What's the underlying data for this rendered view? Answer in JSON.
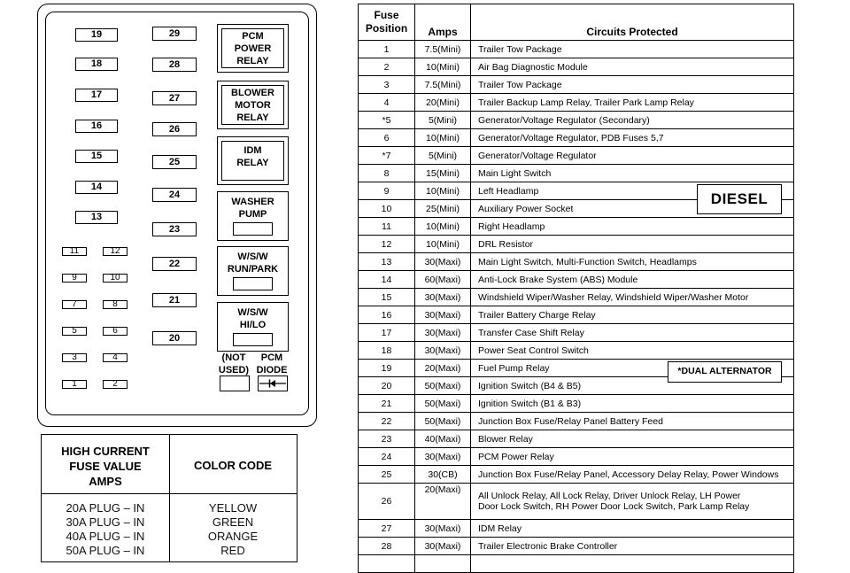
{
  "fuse_box": {
    "left_column_fuses": [
      "19",
      "18",
      "17",
      "16",
      "15",
      "14",
      "13"
    ],
    "middle_column_fuses": [
      "29",
      "28",
      "27",
      "26",
      "25",
      "24",
      "23",
      "22",
      "21",
      "20"
    ],
    "mini_fuses": [
      [
        "11",
        "12"
      ],
      [
        "9",
        "10"
      ],
      [
        "7",
        "8"
      ],
      [
        "5",
        "6"
      ],
      [
        "3",
        "4"
      ],
      [
        "1",
        "2"
      ]
    ],
    "relays": [
      {
        "label": "PCM\nPOWER\nRELAY",
        "style": "inner-box"
      },
      {
        "label": "BLOWER\nMOTOR\nRELAY",
        "style": "inner-box"
      },
      {
        "label": "IDM\nRELAY",
        "style": "inner-box"
      },
      {
        "label": "WASHER\nPUMP",
        "style": "slot"
      },
      {
        "label": "W/S/W\nRUN/PARK",
        "style": "slot"
      },
      {
        "label": "W/S/W\nHI/LO",
        "style": "slot"
      }
    ],
    "not_used_label": "(NOT\nUSED)",
    "pcm_diode_label": "PCM\nDIODE"
  },
  "color_code_table": {
    "header_left": "HIGH CURRENT\nFUSE VALUE\nAMPS",
    "header_right": "COLOR CODE",
    "rows": [
      {
        "value": "20A PLUG – IN",
        "color": "YELLOW"
      },
      {
        "value": "30A PLUG – IN",
        "color": "GREEN"
      },
      {
        "value": "40A PLUG – IN",
        "color": "ORANGE"
      },
      {
        "value": "50A PLUG – IN",
        "color": "RED"
      }
    ]
  },
  "fuse_table": {
    "headers": {
      "position": "Fuse\nPosition",
      "amps": "Amps",
      "circuits": "Circuits Protected"
    },
    "rows": [
      {
        "pos": "1",
        "amps": "7.5(Mini)",
        "circuits": "Trailer Tow Package"
      },
      {
        "pos": "2",
        "amps": "10(Mini)",
        "circuits": "Air Bag Diagnostic Module"
      },
      {
        "pos": "3",
        "amps": "7.5(Mini)",
        "circuits": "Trailer Tow Package"
      },
      {
        "pos": "4",
        "amps": "20(Mini)",
        "circuits": "Trailer Backup Lamp Relay, Trailer Park Lamp Relay"
      },
      {
        "pos": "*5",
        "amps": "5(Mini)",
        "circuits": "Generator/Voltage Regulator (Secondary)"
      },
      {
        "pos": "6",
        "amps": "10(Mini)",
        "circuits": "Generator/Voltage  Regulator, PDB Fuses 5,7"
      },
      {
        "pos": "*7",
        "amps": "5(Mini)",
        "circuits": "Generator/Voltage Regulator"
      },
      {
        "pos": "8",
        "amps": "15(Mini)",
        "circuits": "Main Light Switch"
      },
      {
        "pos": "9",
        "amps": "10(Mini)",
        "circuits": "Left Headlamp"
      },
      {
        "pos": "10",
        "amps": "25(Mini)",
        "circuits": "Auxiliary Power Socket"
      },
      {
        "pos": "11",
        "amps": "10(Mini)",
        "circuits": "Right Headlamp"
      },
      {
        "pos": "12",
        "amps": "10(Mini)",
        "circuits": "DRL Resistor"
      },
      {
        "pos": "13",
        "amps": "30(Maxi)",
        "circuits": "Main Light Switch, Multi-Function Switch, Headlamps"
      },
      {
        "pos": "14",
        "amps": "60(Maxi)",
        "circuits": "Anti-Lock Brake System (ABS) Module"
      },
      {
        "pos": "15",
        "amps": "30(Maxi)",
        "circuits": "Windshield Wiper/Washer Relay, Windshield Wiper/Washer Motor"
      },
      {
        "pos": "16",
        "amps": "30(Maxi)",
        "circuits": "Trailer Battery Charge Relay"
      },
      {
        "pos": "17",
        "amps": "30(Maxi)",
        "circuits": "Transfer Case Shift Relay"
      },
      {
        "pos": "18",
        "amps": "30(Maxi)",
        "circuits": "Power Seat Control Switch"
      },
      {
        "pos": "19",
        "amps": "20(Maxi)",
        "circuits": "Fuel Pump Relay"
      },
      {
        "pos": "20",
        "amps": "50(Maxi)",
        "circuits": "Ignition Switch (B4 & B5)"
      },
      {
        "pos": "21",
        "amps": "50(Maxi)",
        "circuits": "Ignition Switch (B1 & B3)"
      },
      {
        "pos": "22",
        "amps": "50(Maxi)",
        "circuits": "Junction Box Fuse/Relay Panel Battery Feed"
      },
      {
        "pos": "23",
        "amps": "40(Maxi)",
        "circuits": "Blower Relay"
      },
      {
        "pos": "24",
        "amps": "30(Maxi)",
        "circuits": "PCM Power Relay"
      },
      {
        "pos": "25",
        "amps": "30(CB)",
        "circuits": "Junction Box Fuse/Relay Panel, Accessory Delay Relay, Power Windows"
      },
      {
        "pos": "26",
        "amps": "20(Maxi)",
        "circuits": "All Unlock Relay, All Lock Relay, Driver Unlock Relay, LH Power\nDoor Lock Switch, RH Power Door Lock Switch, Park Lamp Relay"
      },
      {
        "pos": "27",
        "amps": "30(Maxi)",
        "circuits": "IDM Relay"
      },
      {
        "pos": "28",
        "amps": "30(Maxi)",
        "circuits": "Trailer Electronic Brake Controller"
      },
      {
        "pos": "",
        "amps": "",
        "circuits": ""
      }
    ]
  },
  "tags": {
    "diesel": "DIESEL",
    "dual_alternator": "*DUAL ALTERNATOR"
  }
}
